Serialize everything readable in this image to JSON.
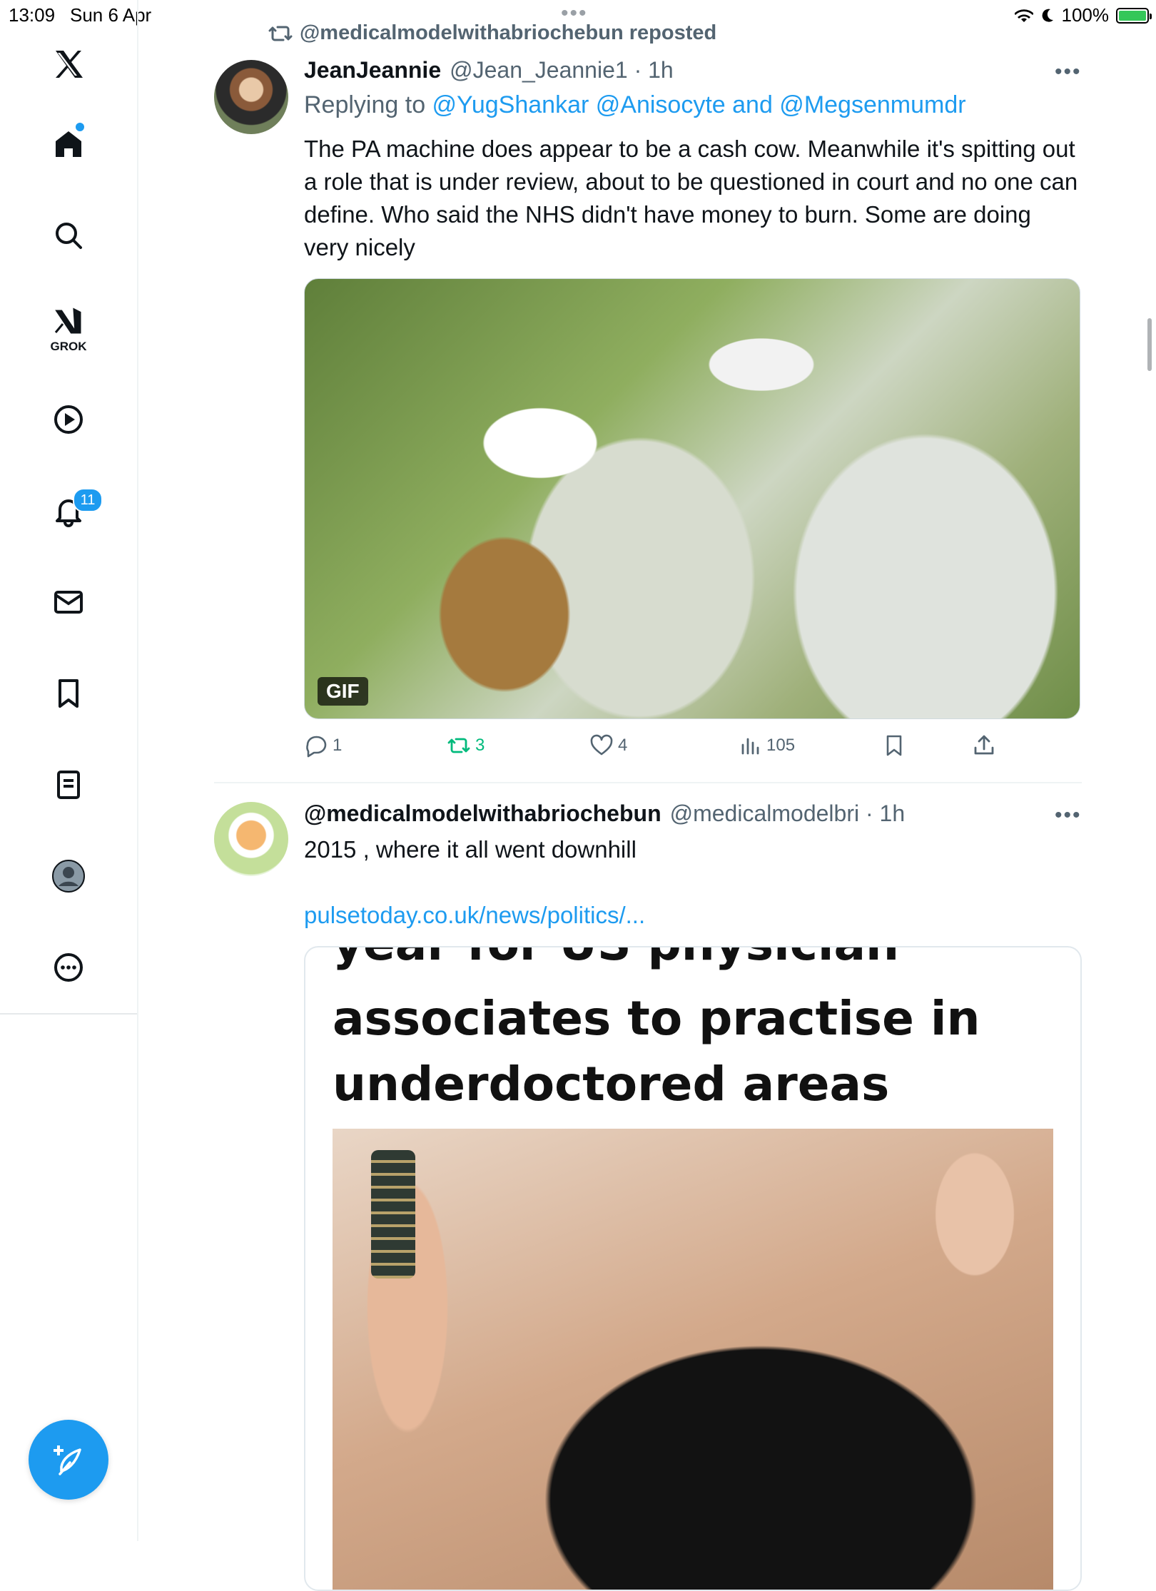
{
  "status_bar": {
    "time": "13:09",
    "date": "Sun 6 Apr",
    "battery": "100%",
    "top_dots": "•••"
  },
  "sidebar": {
    "items": [
      "X",
      "Home",
      "Search",
      "Grok",
      "Videos",
      "Notifications",
      "Messages",
      "Bookmarks",
      "Lists",
      "Profile",
      "More"
    ],
    "grok_label": "GROK",
    "notification_count": "11"
  },
  "repost": {
    "text": "@medicalmodelwithabriochebun reposted"
  },
  "tweet1": {
    "name": "JeanJeannie",
    "handle": "@Jean_Jeannie1 · 1h",
    "more": "•••",
    "replying_prefix": "Replying to ",
    "replying_to": "@YugShankar @Anisocyte and @Megsenmumdr",
    "text": "The PA machine does appear to be a cash cow. Meanwhile it's spitting out a role that is under review, about to be questioned in court and no one can define. Who said the NHS didn't have money to burn. Some are doing very nicely",
    "media_badge": "GIF",
    "replies": "1",
    "reposts": "3",
    "likes": "4",
    "views": "105"
  },
  "tweet2": {
    "name": "@medicalmodelwithabriochebun",
    "handle": "@medicalmodelbri · 1h",
    "more": "•••",
    "text": "2015 , where it all went downhill",
    "link": "pulsetoday.co.uk/news/politics/...",
    "card_clipped_line": "year for US physician",
    "card_title": "associates to practise in underdoctored areas"
  },
  "colors": {
    "accent": "#1d9bf0",
    "repost_green": "#00ba7c",
    "secondary_text": "#536471"
  }
}
